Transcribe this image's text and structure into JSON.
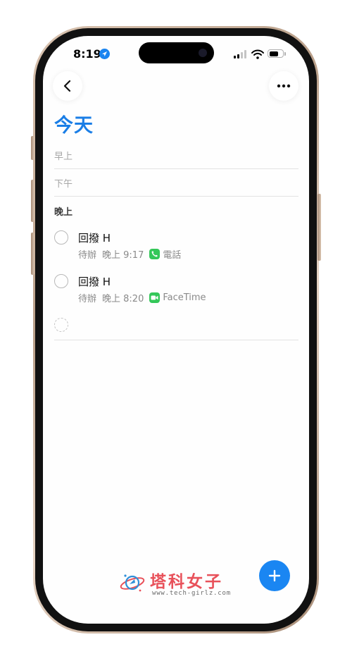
{
  "status_bar": {
    "time": "8:19"
  },
  "page": {
    "title": "今天"
  },
  "sections": [
    {
      "label": "早上"
    },
    {
      "label": "下午"
    },
    {
      "label": "晚上"
    }
  ],
  "reminders": [
    {
      "title": "回撥 H",
      "list": "待辦",
      "time": "晚上 9:17",
      "app_name": "電話",
      "app_icon": "phone-app-icon"
    },
    {
      "title": "回撥 H",
      "list": "待辦",
      "time": "晚上 8:20",
      "app_name": "FaceTime",
      "app_icon": "facetime-app-icon"
    }
  ],
  "watermark": {
    "brand": "塔科女子",
    "url": "www.tech-girlz.com"
  },
  "colors": {
    "accent": "#1a7ee6",
    "fab": "#1a86f2",
    "app_green": "#34c759",
    "watermark": "#e8515a"
  }
}
